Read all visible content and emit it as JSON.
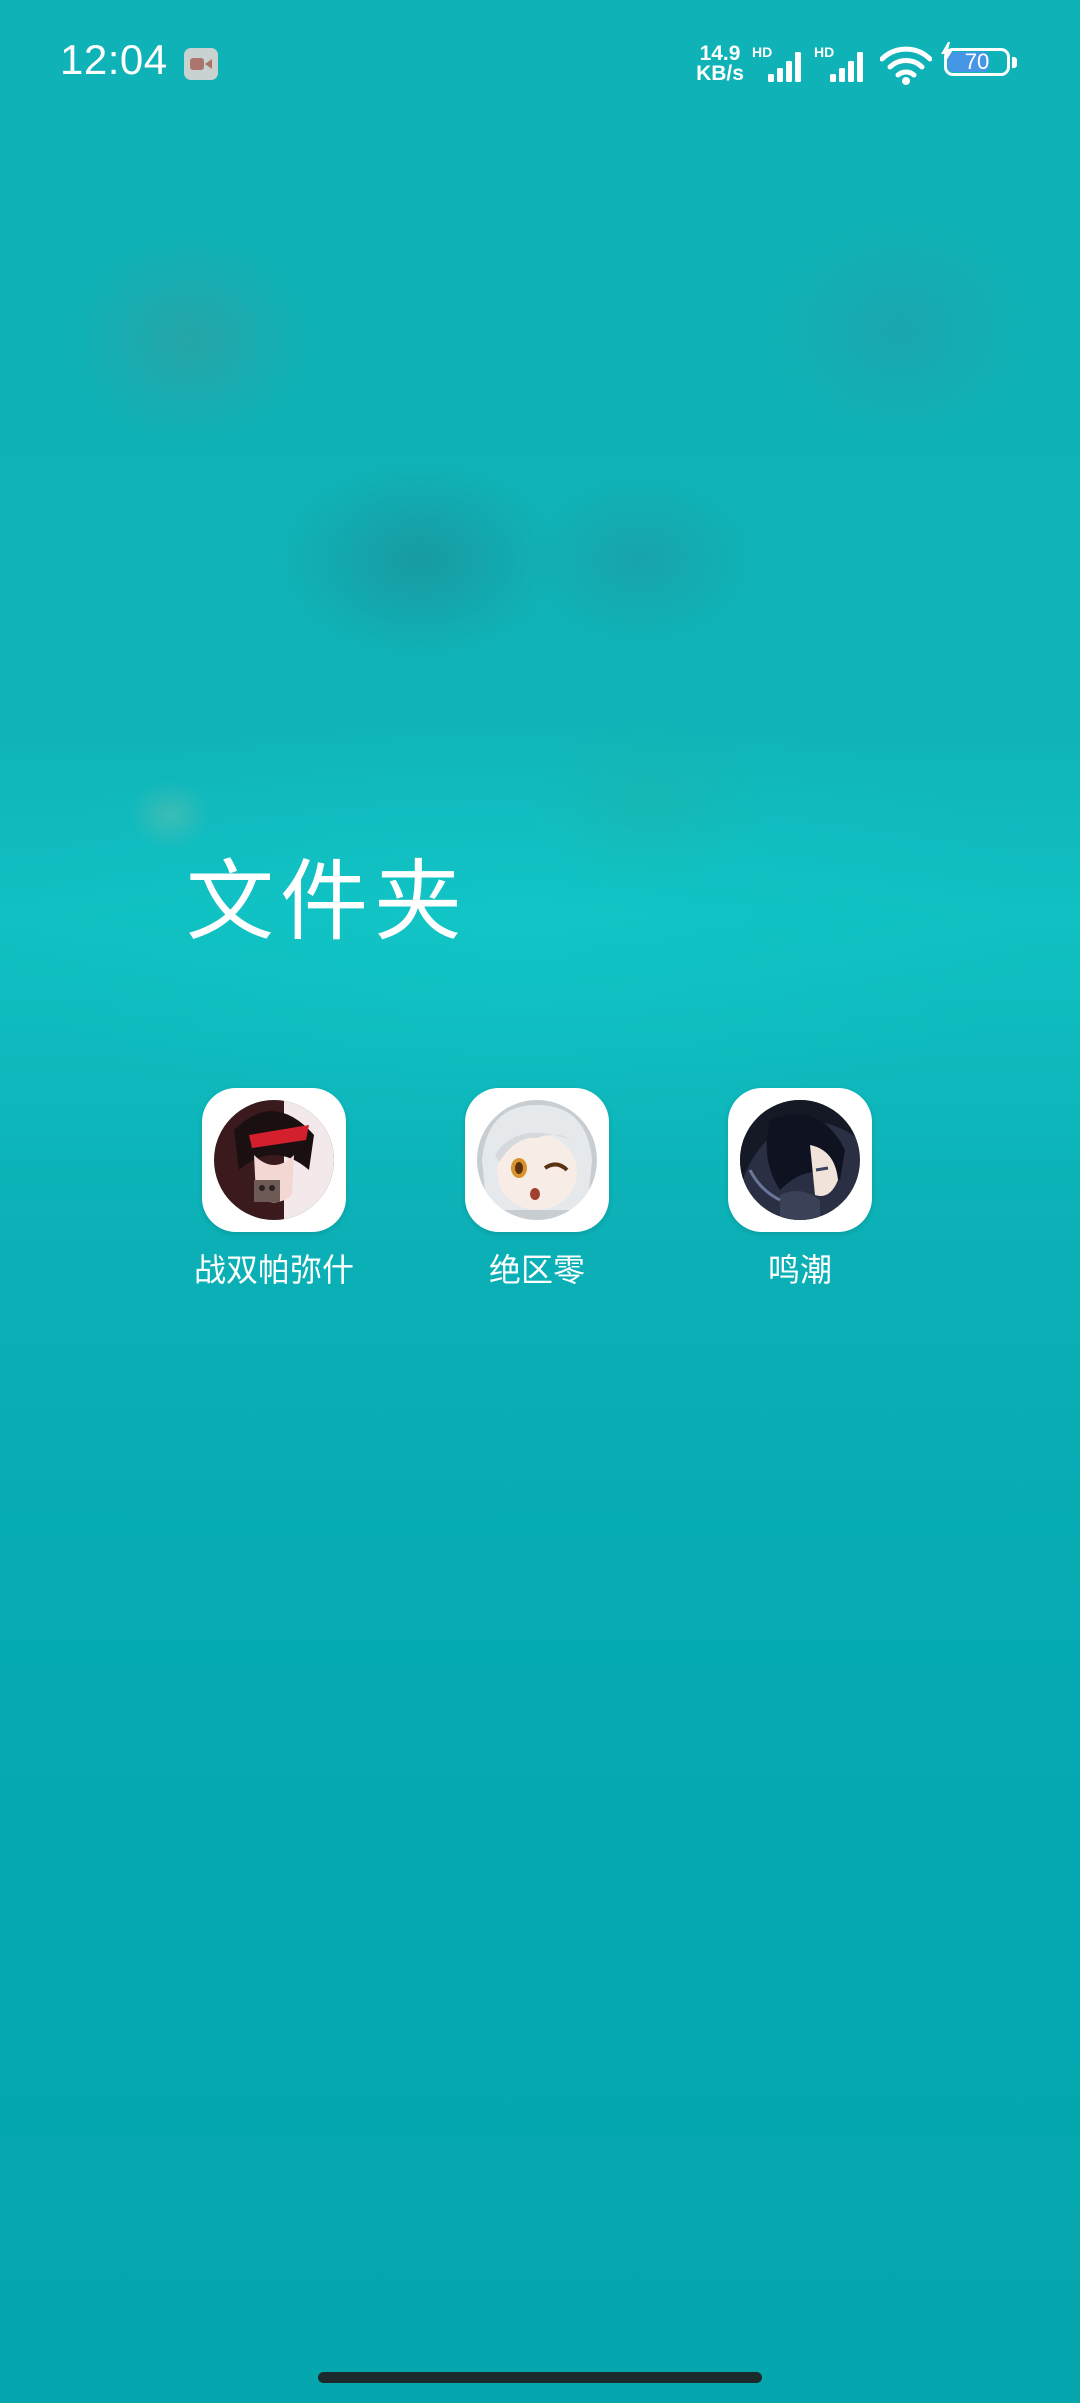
{
  "status_bar": {
    "time": "12:04",
    "net_speed_value": "14.9",
    "net_speed_unit": "KB/s",
    "sim1_label": "HD",
    "sim2_label": "HD",
    "battery_level": "70",
    "battery_fraction": 0.7,
    "icons": [
      "screen-record-icon",
      "signal-icon",
      "wifi-icon",
      "battery-icon",
      "charging-icon"
    ]
  },
  "folder": {
    "title": "文件夹",
    "apps": [
      {
        "label": "战双帕弥什",
        "icon": "punishing-gray-raven-app-icon"
      },
      {
        "label": "绝区零",
        "icon": "zenless-zone-zero-app-icon"
      },
      {
        "label": "鸣潮",
        "icon": "wuthering-waves-app-icon"
      }
    ]
  },
  "colors": {
    "wallpaper": "#0bb0b6",
    "text": "#ffffff",
    "battery_fill": "#4696e6",
    "home_indicator": "#1c2a2c"
  }
}
